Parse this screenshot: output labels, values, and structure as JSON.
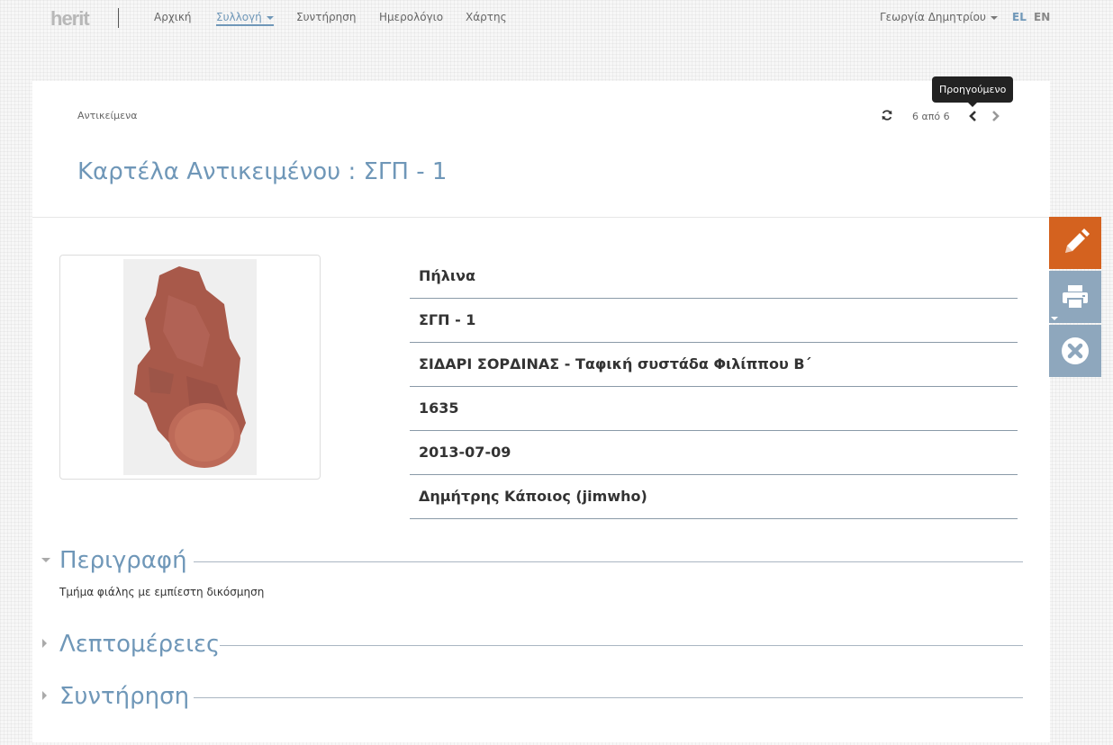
{
  "nav": {
    "logo": "herit",
    "items": [
      {
        "label": "Αρχική"
      },
      {
        "label": "Συλλογή"
      },
      {
        "label": "Συντήρηση"
      },
      {
        "label": "Ημερολόγιο"
      },
      {
        "label": "Χάρτης"
      }
    ],
    "user": "Γεωργία Δημητρίου",
    "lang_el": "EL",
    "lang_en": "EN"
  },
  "header": {
    "breadcrumb": "Αντικείμενα",
    "title": "Καρτέλα Αντικειμένου : ΣΓΠ - 1",
    "pager_count": "6 από 6",
    "tooltip": "Προηγούμενο"
  },
  "fields": [
    {
      "value": "Πήλινα"
    },
    {
      "value": "ΣΓΠ - 1"
    },
    {
      "value": "ΣΙΔΑΡΙ ΣΟΡΔΙΝΑΣ - Ταφική συστάδα Φιλίππου Β΄"
    },
    {
      "value": "1635"
    },
    {
      "value": "2013-07-09"
    },
    {
      "value": "Δημήτρης Κάποιος (jimwho)"
    }
  ],
  "sections": [
    {
      "title": "Περιγραφή",
      "body": "Τμήμα φιάλης με εμπίεστη δικόσμηση",
      "expanded": true
    },
    {
      "title": "Λεπτομέρειες",
      "expanded": false
    },
    {
      "title": "Συντήρηση",
      "expanded": false
    }
  ],
  "colors": {
    "accent": "#6f97b8",
    "edit": "#d4621f",
    "action": "#8ea7bd"
  },
  "icons": {
    "refresh": "refresh-icon",
    "prev": "chevron-left-icon",
    "next": "chevron-right-icon",
    "edit": "pencil-icon",
    "print": "printer-icon",
    "close": "close-circle-icon"
  }
}
